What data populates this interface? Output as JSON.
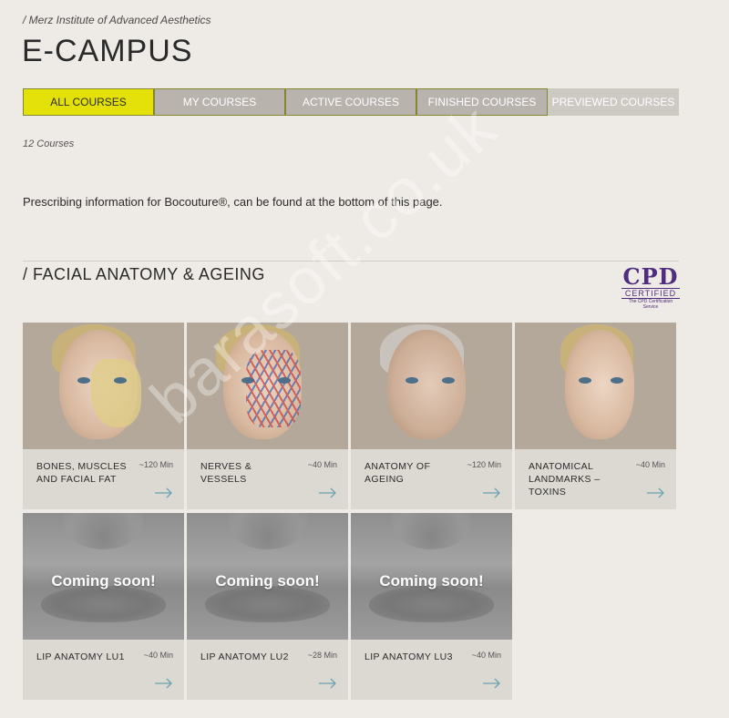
{
  "header": {
    "breadcrumb": "/ Merz Institute of Advanced Aesthetics",
    "title": "E-CAMPUS"
  },
  "tabs": [
    {
      "label": "ALL COURSES",
      "active": true
    },
    {
      "label": "MY COURSES",
      "active": false
    },
    {
      "label": "ACTIVE COURSES",
      "active": false
    },
    {
      "label": "FINISHED COURSES",
      "active": false
    },
    {
      "label": "PREVIEWED COURSES",
      "active": false
    }
  ],
  "course_count": "12 Courses",
  "prescribing_text": "Prescribing information for Bocouture®, can be found at the bottom of this page.",
  "section": {
    "title": "/ FACIAL ANATOMY & AGEING",
    "badge": {
      "big": "CPD",
      "certified": "CERTIFIED",
      "sub1": "The CPD Certification",
      "sub2": "Service"
    }
  },
  "courses": [
    {
      "title": "BONES, MUSCLES AND FACIAL FAT",
      "duration": "~120 Min",
      "image": "face-bones"
    },
    {
      "title": "NERVES & VESSELS",
      "duration": "~40 Min",
      "image": "face-vessels"
    },
    {
      "title": "ANATOMY OF AGEING",
      "duration": "~120 Min",
      "image": "face-aged"
    },
    {
      "title": "ANATOMICAL LANDMARKS – TOXINS",
      "duration": "~40 Min",
      "image": "face-plain"
    },
    {
      "title": "LIP ANATOMY LU1",
      "duration": "~40 Min",
      "image": "lips",
      "overlay": "Coming soon!"
    },
    {
      "title": "LIP ANATOMY LU2",
      "duration": "~28 Min",
      "image": "lips",
      "overlay": "Coming soon!"
    },
    {
      "title": "LIP ANATOMY LU3",
      "duration": "~40 Min",
      "image": "lips",
      "overlay": "Coming soon!"
    }
  ],
  "watermark": "barasoft.co.uk",
  "colors": {
    "background": "#eeeae5",
    "active_tab": "#e3e00a",
    "tab": "#b8b3ad",
    "card": "#dcd8d2",
    "arrow": "#6aa3b3",
    "cpd": "#4f2d7f"
  }
}
